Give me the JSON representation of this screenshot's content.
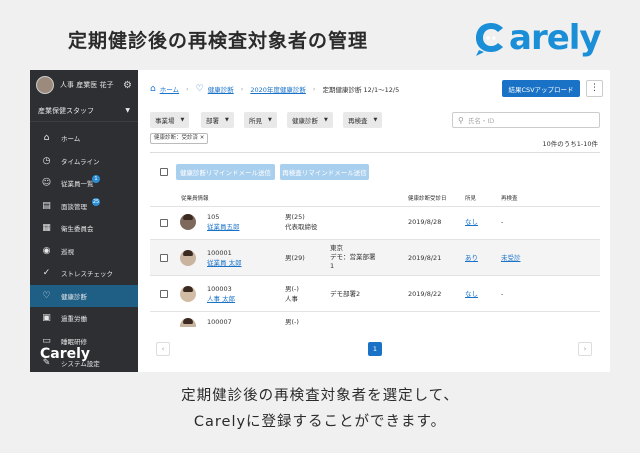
{
  "slide": {
    "title": "定期健診後の再検査対象者の管理",
    "brand": "arely",
    "caption_line1": "定期健診後の再検査対象者を選定して、",
    "caption_line2": "Carelyに登録することができます。"
  },
  "sidebar": {
    "user_name": "人事 産業医 花子",
    "role": "産業保健スタッフ",
    "items": [
      {
        "label": "ホーム",
        "icon": "home-icon",
        "glyph": "⌂"
      },
      {
        "label": "タイムライン",
        "icon": "clock-icon",
        "glyph": "◷"
      },
      {
        "label": "従業員一覧",
        "icon": "people-icon",
        "glyph": "☺",
        "badge": "1"
      },
      {
        "label": "面談管理",
        "icon": "chat-icon",
        "glyph": "▤",
        "badge": "25"
      },
      {
        "label": "衛生委員会",
        "icon": "clipboard-icon",
        "glyph": "▦"
      },
      {
        "label": "巡視",
        "icon": "eye-icon",
        "glyph": "◉"
      },
      {
        "label": "ストレスチェック",
        "icon": "check-icon",
        "glyph": "✓"
      },
      {
        "label": "健康診断",
        "icon": "heart-icon",
        "glyph": "♡",
        "active": true
      },
      {
        "label": "過重労働",
        "icon": "briefcase-icon",
        "glyph": "▣"
      },
      {
        "label": "睡眠研修",
        "icon": "bed-icon",
        "glyph": "▭"
      },
      {
        "label": "システム設定",
        "icon": "wrench-icon",
        "glyph": "✎"
      }
    ],
    "logo": "Carely"
  },
  "breadcrumb": {
    "home": "ホーム",
    "health": "健康診断",
    "year": "2020年度健康診断",
    "current": "定期健康診断 12/1〜12/5"
  },
  "toolbar": {
    "csv_button": "結果CSVアップロード",
    "more": "⋮"
  },
  "filters": {
    "office": "事業場",
    "dept": "部署",
    "finding": "所見",
    "status": "健康診断",
    "recheck": "再検査",
    "search_placeholder": "氏名・ID"
  },
  "chip": "健康診断：受診済 ✕",
  "count_text": "10件のうち1-10件",
  "actions": {
    "remind_health": "健康診断リマインドメール送信",
    "remind_recheck": "再検査リマインドメール送信"
  },
  "columns": {
    "employee": "従業員情報",
    "date": "健康診断受診日",
    "finding": "所見",
    "recheck": "再検査"
  },
  "rows": [
    {
      "id": "105",
      "name": "従業員五郎",
      "attr": "男(25)",
      "attr2": "代表取締役",
      "dept": "",
      "dept2": "",
      "dept3": "",
      "date": "2019/8/28",
      "finding": "なし",
      "recheck": "-"
    },
    {
      "id": "100001",
      "name": "従業員 太郎",
      "attr": "男(29)",
      "attr2": "",
      "dept": "東京",
      "dept2": "デモ：営業部署",
      "dept3": "1",
      "date": "2019/8/21",
      "finding": "あり",
      "recheck": "未受診"
    },
    {
      "id": "100003",
      "name": "人事 太郎",
      "attr": "男(-)",
      "attr2": "人事",
      "dept": "デモ部署2",
      "dept2": "",
      "dept3": "",
      "date": "2019/8/22",
      "finding": "なし",
      "recheck": "-"
    },
    {
      "id": "100007",
      "name": "",
      "attr": "男(-)",
      "attr2": "",
      "dept": "",
      "dept2": "",
      "dept3": "",
      "date": "",
      "finding": "",
      "recheck": ""
    }
  ],
  "pager": {
    "prev": "‹",
    "page": "1",
    "next": "›"
  },
  "colors": {
    "sidebar_bg": "#2d2f33",
    "active_bg": "#1f5f86",
    "primary": "#1a72c6",
    "brand": "#1a8fd8"
  }
}
